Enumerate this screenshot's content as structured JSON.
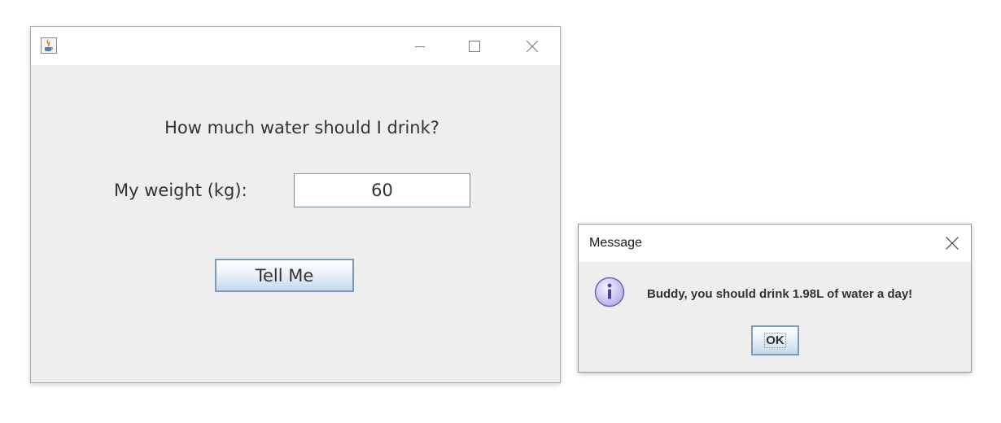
{
  "main_window": {
    "title": "",
    "heading": "How much water should I drink?",
    "weight_label": "My weight (kg):",
    "weight_value": "60",
    "submit_label": "Tell Me",
    "window_controls": [
      "minimize-icon",
      "maximize-icon",
      "close-icon"
    ],
    "app_icon": "java-cup-icon"
  },
  "dialog": {
    "title": "Message",
    "message": "Buddy, you should drink 1.98L of water a day!",
    "ok_label": "OK",
    "icon": "information-icon",
    "close_icon": "close-icon"
  },
  "colors": {
    "window_bg": "#eeeeee",
    "titlebar_bg": "#ffffff",
    "button_border": "#7c9bbb",
    "info_icon_fill": "#c8c4f0",
    "info_icon_stroke": "#6a63b8"
  }
}
